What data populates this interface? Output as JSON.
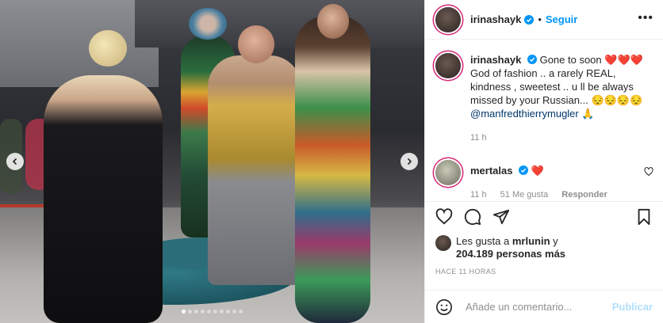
{
  "post": {
    "author": {
      "username": "irinashayk",
      "follow_label": "Seguir",
      "separator": "•",
      "more_label": "•••"
    },
    "caption": {
      "username": "irinashayk",
      "text_1": "Gone to soon",
      "hearts": "❤️❤️❤️",
      "text_2": "God of fashion .. a rarely REAL, kindness , sweetest .. u ll be always missed by your Russian...",
      "faces": "😔😔😔😔",
      "mention": "@manfredthierrymugler",
      "mention_emoji": "🙏",
      "time": "11 h"
    },
    "comments": [
      {
        "username": "mertalas",
        "text": "❤️",
        "time": "11 h",
        "likes": "51 Me gusta",
        "reply_label": "Responder"
      }
    ],
    "likes": {
      "prefix": "Les gusta a",
      "first_user": "mrlunin",
      "joiner": "y",
      "count": "204.189 personas más"
    },
    "timestamp": "HACE 11 HORAS",
    "add_comment": {
      "placeholder": "Añade un comentario...",
      "publish_label": "Publicar"
    },
    "carousel": {
      "total_slides": 10,
      "active_slide": 1
    }
  },
  "colors": {
    "accent_blue": "#0095f6",
    "publish_disabled": "#b2dffc",
    "text": "#262626",
    "muted": "#8e8e8e",
    "heart_red": "#d0182c"
  },
  "icons": [
    "chevron-left-icon",
    "chevron-right-icon",
    "verified-icon",
    "more-icon",
    "heart-icon",
    "comment-icon",
    "share-icon",
    "bookmark-icon",
    "emoji-icon"
  ]
}
